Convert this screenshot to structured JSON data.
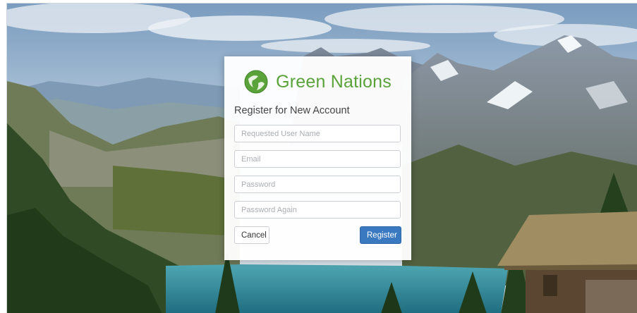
{
  "brand": {
    "name": "Green Nations",
    "logo_icon": "globe-leaf-icon",
    "brand_color": "#5aa33a"
  },
  "form": {
    "title": "Register for New Account",
    "username_placeholder": "Requested User Name",
    "email_placeholder": "Email",
    "password_placeholder": "Password",
    "password_again_placeholder": "Password Again",
    "username_value": "",
    "email_value": "",
    "password_value": "",
    "password_again_value": ""
  },
  "actions": {
    "cancel_label": "Cancel",
    "register_label": "Register",
    "register_color": "#3a78c0"
  }
}
